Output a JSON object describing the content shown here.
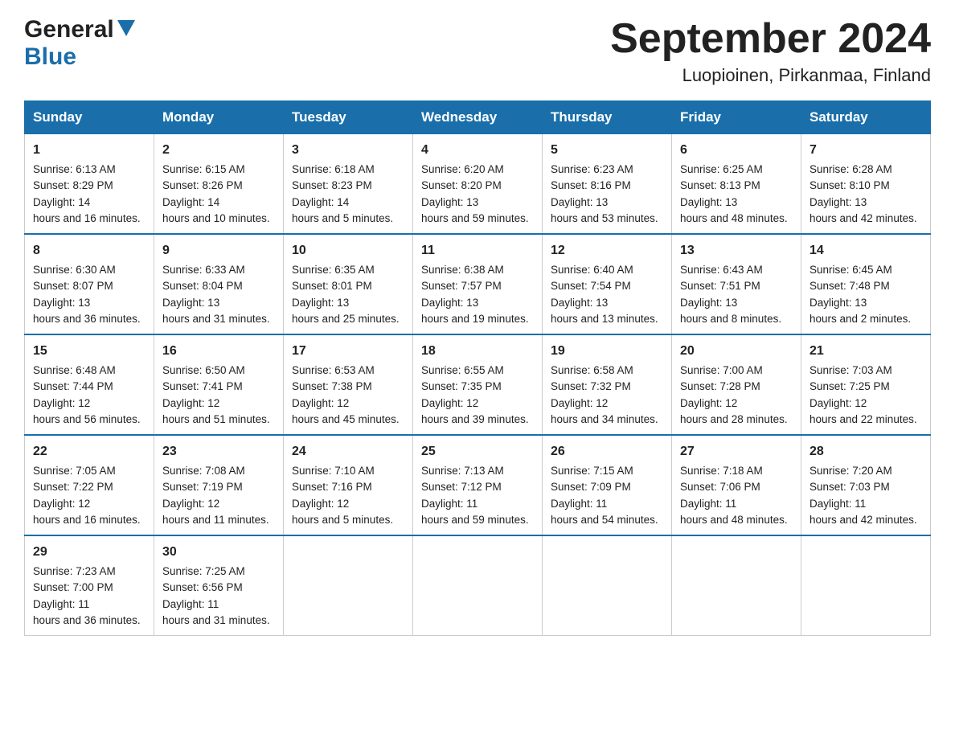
{
  "logo": {
    "general": "General",
    "blue": "Blue"
  },
  "title": {
    "month_year": "September 2024",
    "location": "Luopioinen, Pirkanmaa, Finland"
  },
  "weekdays": [
    "Sunday",
    "Monday",
    "Tuesday",
    "Wednesday",
    "Thursday",
    "Friday",
    "Saturday"
  ],
  "weeks": [
    [
      {
        "day": "1",
        "sunrise": "6:13 AM",
        "sunset": "8:29 PM",
        "daylight": "14 hours and 16 minutes."
      },
      {
        "day": "2",
        "sunrise": "6:15 AM",
        "sunset": "8:26 PM",
        "daylight": "14 hours and 10 minutes."
      },
      {
        "day": "3",
        "sunrise": "6:18 AM",
        "sunset": "8:23 PM",
        "daylight": "14 hours and 5 minutes."
      },
      {
        "day": "4",
        "sunrise": "6:20 AM",
        "sunset": "8:20 PM",
        "daylight": "13 hours and 59 minutes."
      },
      {
        "day": "5",
        "sunrise": "6:23 AM",
        "sunset": "8:16 PM",
        "daylight": "13 hours and 53 minutes."
      },
      {
        "day": "6",
        "sunrise": "6:25 AM",
        "sunset": "8:13 PM",
        "daylight": "13 hours and 48 minutes."
      },
      {
        "day": "7",
        "sunrise": "6:28 AM",
        "sunset": "8:10 PM",
        "daylight": "13 hours and 42 minutes."
      }
    ],
    [
      {
        "day": "8",
        "sunrise": "6:30 AM",
        "sunset": "8:07 PM",
        "daylight": "13 hours and 36 minutes."
      },
      {
        "day": "9",
        "sunrise": "6:33 AM",
        "sunset": "8:04 PM",
        "daylight": "13 hours and 31 minutes."
      },
      {
        "day": "10",
        "sunrise": "6:35 AM",
        "sunset": "8:01 PM",
        "daylight": "13 hours and 25 minutes."
      },
      {
        "day": "11",
        "sunrise": "6:38 AM",
        "sunset": "7:57 PM",
        "daylight": "13 hours and 19 minutes."
      },
      {
        "day": "12",
        "sunrise": "6:40 AM",
        "sunset": "7:54 PM",
        "daylight": "13 hours and 13 minutes."
      },
      {
        "day": "13",
        "sunrise": "6:43 AM",
        "sunset": "7:51 PM",
        "daylight": "13 hours and 8 minutes."
      },
      {
        "day": "14",
        "sunrise": "6:45 AM",
        "sunset": "7:48 PM",
        "daylight": "13 hours and 2 minutes."
      }
    ],
    [
      {
        "day": "15",
        "sunrise": "6:48 AM",
        "sunset": "7:44 PM",
        "daylight": "12 hours and 56 minutes."
      },
      {
        "day": "16",
        "sunrise": "6:50 AM",
        "sunset": "7:41 PM",
        "daylight": "12 hours and 51 minutes."
      },
      {
        "day": "17",
        "sunrise": "6:53 AM",
        "sunset": "7:38 PM",
        "daylight": "12 hours and 45 minutes."
      },
      {
        "day": "18",
        "sunrise": "6:55 AM",
        "sunset": "7:35 PM",
        "daylight": "12 hours and 39 minutes."
      },
      {
        "day": "19",
        "sunrise": "6:58 AM",
        "sunset": "7:32 PM",
        "daylight": "12 hours and 34 minutes."
      },
      {
        "day": "20",
        "sunrise": "7:00 AM",
        "sunset": "7:28 PM",
        "daylight": "12 hours and 28 minutes."
      },
      {
        "day": "21",
        "sunrise": "7:03 AM",
        "sunset": "7:25 PM",
        "daylight": "12 hours and 22 minutes."
      }
    ],
    [
      {
        "day": "22",
        "sunrise": "7:05 AM",
        "sunset": "7:22 PM",
        "daylight": "12 hours and 16 minutes."
      },
      {
        "day": "23",
        "sunrise": "7:08 AM",
        "sunset": "7:19 PM",
        "daylight": "12 hours and 11 minutes."
      },
      {
        "day": "24",
        "sunrise": "7:10 AM",
        "sunset": "7:16 PM",
        "daylight": "12 hours and 5 minutes."
      },
      {
        "day": "25",
        "sunrise": "7:13 AM",
        "sunset": "7:12 PM",
        "daylight": "11 hours and 59 minutes."
      },
      {
        "day": "26",
        "sunrise": "7:15 AM",
        "sunset": "7:09 PM",
        "daylight": "11 hours and 54 minutes."
      },
      {
        "day": "27",
        "sunrise": "7:18 AM",
        "sunset": "7:06 PM",
        "daylight": "11 hours and 48 minutes."
      },
      {
        "day": "28",
        "sunrise": "7:20 AM",
        "sunset": "7:03 PM",
        "daylight": "11 hours and 42 minutes."
      }
    ],
    [
      {
        "day": "29",
        "sunrise": "7:23 AM",
        "sunset": "7:00 PM",
        "daylight": "11 hours and 36 minutes."
      },
      {
        "day": "30",
        "sunrise": "7:25 AM",
        "sunset": "6:56 PM",
        "daylight": "11 hours and 31 minutes."
      },
      null,
      null,
      null,
      null,
      null
    ]
  ],
  "labels": {
    "sunrise": "Sunrise:",
    "sunset": "Sunset:",
    "daylight": "Daylight:"
  }
}
